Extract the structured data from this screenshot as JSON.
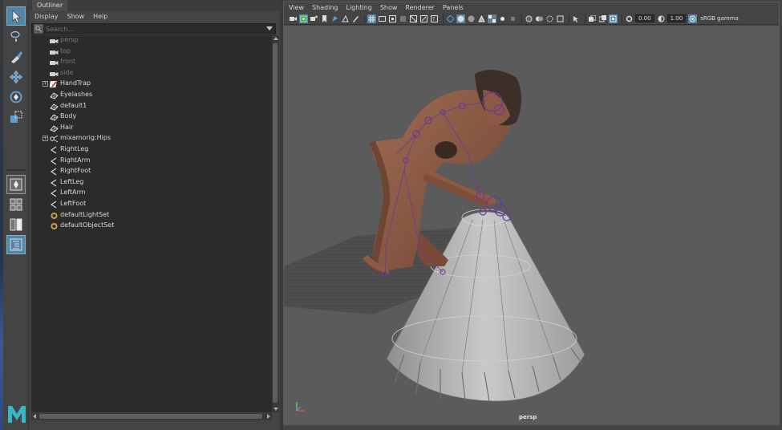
{
  "outliner": {
    "tab_title": "Outliner",
    "menu": [
      "Display",
      "Show",
      "Help"
    ],
    "search_placeholder": "Search...",
    "items": [
      {
        "label": "persp",
        "icon": "camera-icon",
        "dim": true,
        "expandable": false
      },
      {
        "label": "top",
        "icon": "camera-icon",
        "dim": true,
        "expandable": false
      },
      {
        "label": "front",
        "icon": "camera-icon",
        "dim": true,
        "expandable": false
      },
      {
        "label": "side",
        "icon": "camera-icon",
        "dim": true,
        "expandable": false
      },
      {
        "label": "HandTrap",
        "icon": "transform-icon",
        "dim": false,
        "expandable": true
      },
      {
        "label": "Eyelashes",
        "icon": "mesh-icon",
        "dim": false,
        "expandable": false
      },
      {
        "label": "default1",
        "icon": "mesh-icon",
        "dim": false,
        "expandable": false
      },
      {
        "label": "Body",
        "icon": "mesh-icon",
        "dim": false,
        "expandable": false
      },
      {
        "label": "Hair",
        "icon": "mesh-icon",
        "dim": false,
        "expandable": false
      },
      {
        "label": "mixamorig:Hips",
        "icon": "joint-icon",
        "dim": false,
        "expandable": true
      },
      {
        "label": "RightLeg",
        "icon": "ik-handle-icon",
        "dim": false,
        "expandable": false
      },
      {
        "label": "RightArm",
        "icon": "ik-handle-icon",
        "dim": false,
        "expandable": false
      },
      {
        "label": "RightFoot",
        "icon": "ik-handle-icon",
        "dim": false,
        "expandable": false
      },
      {
        "label": "LeftLeg",
        "icon": "ik-handle-icon",
        "dim": false,
        "expandable": false
      },
      {
        "label": "LeftArm",
        "icon": "ik-handle-icon",
        "dim": false,
        "expandable": false
      },
      {
        "label": "LeftFoot",
        "icon": "ik-handle-icon",
        "dim": false,
        "expandable": false
      },
      {
        "label": "defaultLightSet",
        "icon": "set-icon",
        "dim": false,
        "expandable": false
      },
      {
        "label": "defaultObjectSet",
        "icon": "set-icon",
        "dim": false,
        "expandable": false
      }
    ]
  },
  "viewport": {
    "menu": [
      "View",
      "Shading",
      "Lighting",
      "Show",
      "Renderer",
      "Panels"
    ],
    "exposure": "0.00",
    "gamma": "1.00",
    "color_space": "sRGB gamma",
    "camera_label": "persp"
  },
  "toolbox": {
    "tools": [
      "select-tool-icon",
      "lasso-tool-icon",
      "paint-select-tool-icon",
      "move-tool-icon",
      "rotate-tool-icon",
      "scale-tool-icon"
    ],
    "layouts": [
      "single-pane-layout-icon",
      "four-pane-layout-icon",
      "two-pane-layout-icon",
      "outliner-layout-icon"
    ]
  },
  "colors": {
    "accent": "#5285a6",
    "viewport_bg": "#5b5b5b",
    "panel_bg": "#444444",
    "list_bg": "#2b2b2b"
  }
}
